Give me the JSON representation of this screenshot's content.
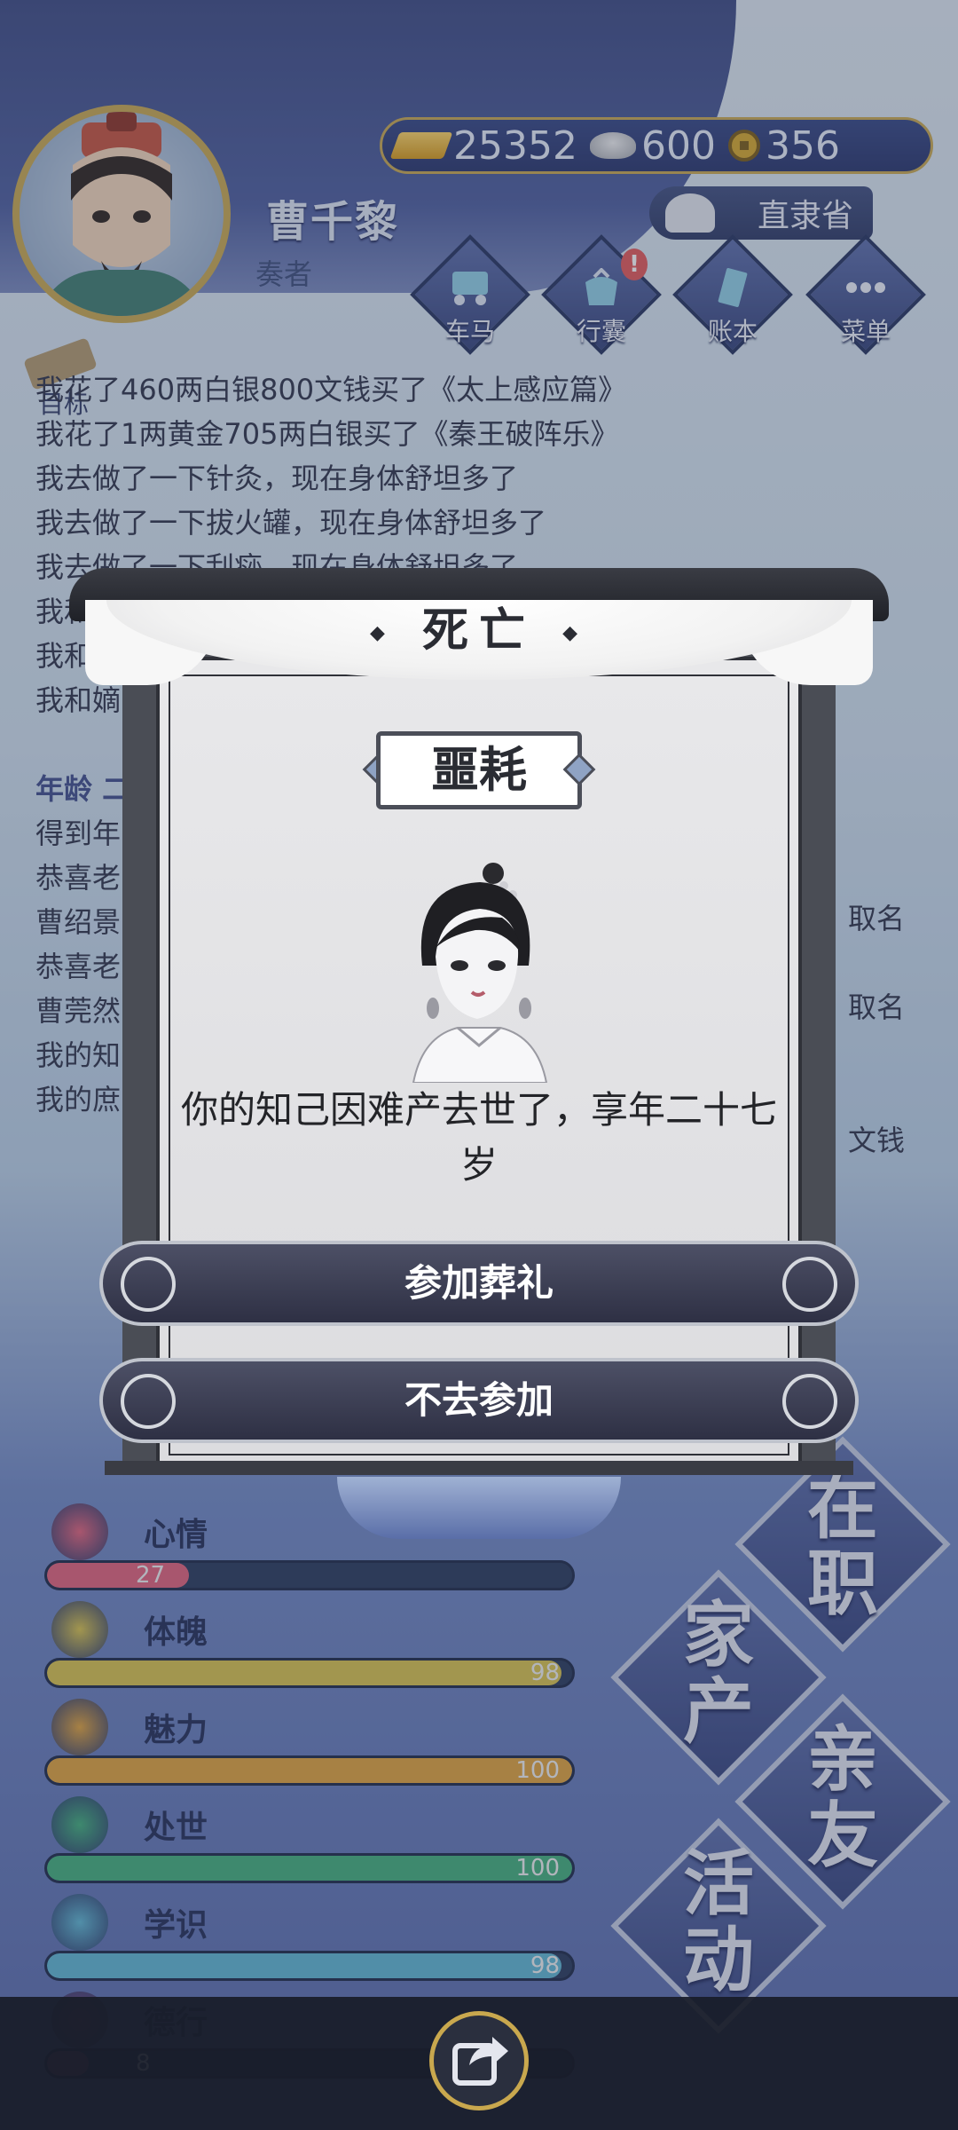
{
  "player": {
    "name": "曹千黎",
    "title": "奏者"
  },
  "currency": {
    "gold": "25352",
    "silver": "600",
    "coin": "356"
  },
  "location": "直隶省",
  "menu": [
    {
      "label": "车马",
      "icon": "carriage-icon"
    },
    {
      "label": "行囊",
      "icon": "bag-icon",
      "alert": "!"
    },
    {
      "label": "账本",
      "icon": "ledger-icon"
    },
    {
      "label": "菜单",
      "icon": "more-icon"
    }
  ],
  "goal_label": "目标",
  "log": {
    "lines_top": [
      "我花了460两白银800文钱买了《太上感应篇》",
      "我花了1两黄金705两白银买了《秦王破阵乐》",
      "我去做了一下针灸，现在身体舒坦多了",
      "我去做了一下拔火罐，现在身体舒坦多了",
      "我去做了一下刮痧，现在身体舒坦多了",
      "我和",
      "我和",
      "我和嫡"
    ],
    "section_label": "年龄 二",
    "lines_bottom": [
      "得到年",
      "恭喜老",
      "曹绍景",
      "恭喜老",
      "曹莞然",
      "我的知",
      "我的庶"
    ],
    "right_fragments": [
      "取名",
      "取名",
      "文钱"
    ]
  },
  "dialog": {
    "header": "死亡",
    "badge": "噩耗",
    "message": "你的知己因难产去世了，享年二十七岁",
    "attend_button": "参加葬礼",
    "decline_button": "不去参加"
  },
  "stats": [
    {
      "label": "心情",
      "value": 27,
      "max": 100,
      "color": "#e2607a",
      "icon": "flower-icon"
    },
    {
      "label": "体魄",
      "value": 98,
      "max": 100,
      "color": "#d9c24a",
      "icon": "strength-icon"
    },
    {
      "label": "魅力",
      "value": 100,
      "max": 100,
      "color": "#e0a13a",
      "icon": "charm-icon"
    },
    {
      "label": "处世",
      "value": 100,
      "max": 100,
      "color": "#3fae7a",
      "icon": "conduct-icon"
    },
    {
      "label": "学识",
      "value": 98,
      "max": 100,
      "color": "#5db6d3",
      "icon": "knowledge-icon"
    },
    {
      "label": "德行",
      "value": "8",
      "max": 100,
      "color": "#7a3d78",
      "icon": "virtue-icon"
    }
  ],
  "actions": [
    {
      "label": "在职"
    },
    {
      "label": "家产"
    },
    {
      "label": "亲友"
    },
    {
      "label": "活动"
    }
  ],
  "share_icon": "share-icon"
}
